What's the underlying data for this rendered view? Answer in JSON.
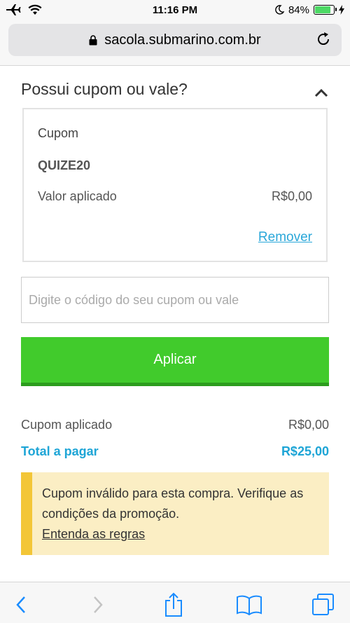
{
  "status_bar": {
    "time": "11:16 PM",
    "battery_percent": "84%",
    "battery_level": 0.84,
    "icons": [
      "airplane-icon",
      "wifi-icon",
      "moon-icon",
      "battery-icon",
      "charging-icon"
    ]
  },
  "browser": {
    "url": "sacola.submarino.com.br",
    "icons": [
      "lock-icon",
      "reload-icon"
    ]
  },
  "coupon_section": {
    "title": "Possui cupom ou vale?",
    "card": {
      "label": "Cupom",
      "code": "QUIZE20",
      "applied_label": "Valor aplicado",
      "applied_value": "R$0,00",
      "remove_label": "Remover"
    },
    "input_placeholder": "Digite o código do seu cupom ou vale",
    "apply_label": "Aplicar"
  },
  "summary": {
    "coupon_label": "Cupom aplicado",
    "coupon_value": "R$0,00",
    "total_label": "Total a pagar",
    "total_value": "R$25,00"
  },
  "warning": {
    "message": "Cupom inválido para esta compra. Verifique as condições da promoção.",
    "link": "Entenda as regras"
  },
  "toolbar": {
    "icons": [
      "back-icon",
      "forward-icon",
      "share-icon",
      "bookmarks-icon",
      "tabs-icon"
    ]
  },
  "colors": {
    "accent_green": "#41cb2c",
    "total_blue": "#1ea5d6",
    "link_blue": "#2aa7d9",
    "warning_bg": "#fbeec4",
    "warning_border": "#f3c637"
  }
}
